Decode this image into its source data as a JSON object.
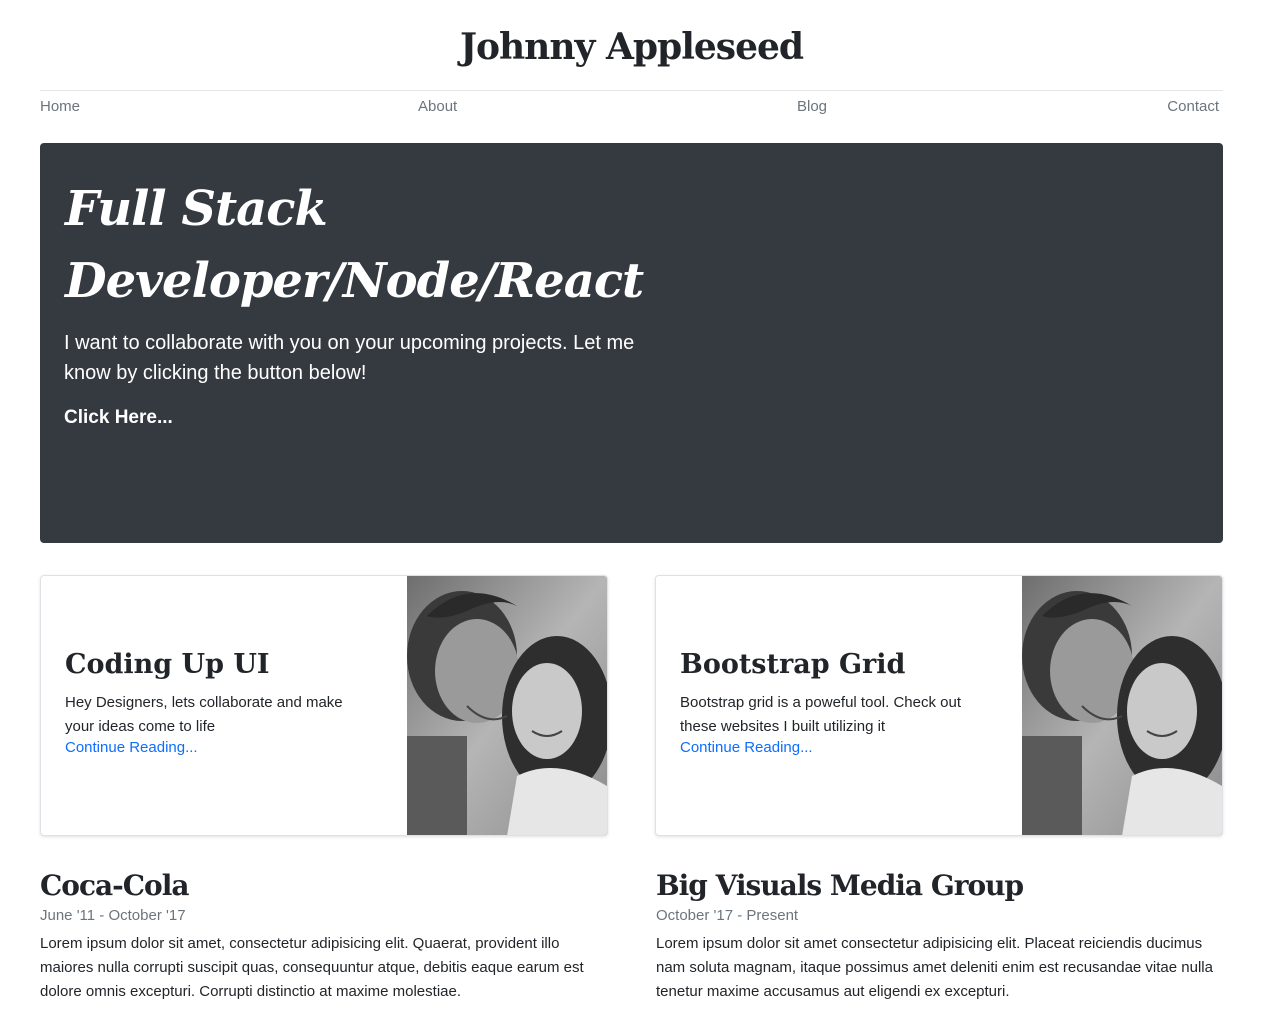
{
  "header": {
    "title": "Johnny Appleseed"
  },
  "nav": {
    "items": [
      "Home",
      "About",
      "Blog",
      "Contact"
    ]
  },
  "hero": {
    "title_line1": "Full Stack",
    "title_line2": "Developer/Node/React",
    "lead": "I want to collaborate with you on your upcoming projects. Let me know by clicking the button below!",
    "link": "Click Here..."
  },
  "cards": [
    {
      "title": "Coding Up UI",
      "text": "Hey Designers, lets collaborate and make your ideas come to life",
      "link": "Continue Reading...",
      "image_icon": "couple-photo"
    },
    {
      "title": "Bootstrap Grid",
      "text": "Bootstrap grid is a poweful tool. Check out these websites I built utilizing it",
      "link": "Continue Reading...",
      "image_icon": "couple-photo"
    }
  ],
  "jobs": [
    {
      "company": "Coca-Cola",
      "dates": "June '11 - October '17",
      "description": "Lorem ipsum dolor sit amet, consectetur adipisicing elit. Quaerat, provident illo maiores nulla corrupti suscipit quas, consequuntur atque, debitis eaque earum est dolore omnis excepturi. Corrupti distinctio at maxime molestiae."
    },
    {
      "company": "Big Visuals Media Group",
      "dates": "October '17 - Present",
      "description": "Lorem ipsum dolor sit amet consectetur adipisicing elit. Placeat reiciendis ducimus nam soluta magnam, itaque possimus amet deleniti enim est recusandae vitae nulla tenetur maxime accusamus aut eligendi ex excepturi."
    }
  ],
  "colors": {
    "hero_bg": "#343a40",
    "link": "#0d6efd",
    "muted": "#6c757d"
  }
}
